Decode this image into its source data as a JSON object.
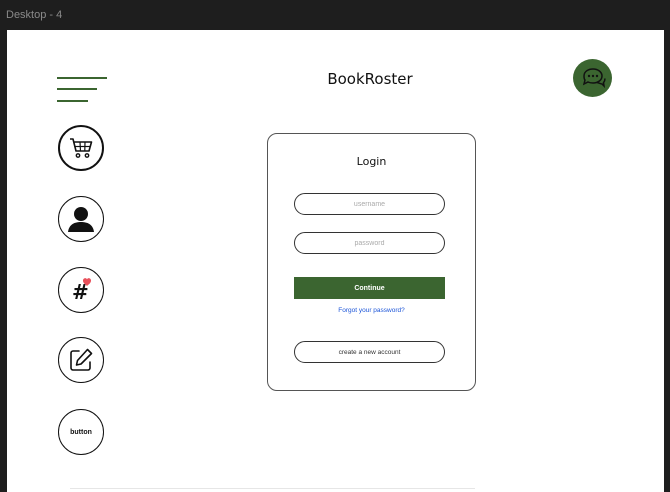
{
  "canvas": {
    "frame_label": "Desktop - 4"
  },
  "header": {
    "title": "BookRoster",
    "menu_icon": "hamburger-menu-icon",
    "chat_icon": "chat-bubbles-icon"
  },
  "sidebar": {
    "items": [
      {
        "icon": "cart-icon"
      },
      {
        "icon": "user-icon"
      },
      {
        "icon": "hashtag-heart-icon"
      },
      {
        "icon": "edit-icon"
      },
      {
        "label": "button"
      }
    ]
  },
  "login": {
    "title": "Login",
    "username_placeholder": "username",
    "password_placeholder": "password",
    "continue_label": "Continue",
    "forgot_label": "Forgot your password?",
    "create_label": "create a new account"
  },
  "colors": {
    "brand_green": "#3b6530",
    "link_blue": "#1c55d8",
    "heart_red": "#e8505b"
  }
}
